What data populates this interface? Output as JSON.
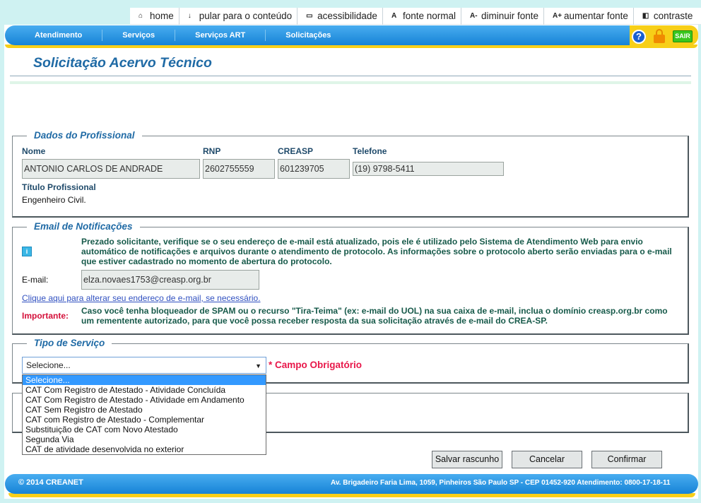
{
  "topbar": [
    {
      "icon": "⌂",
      "label": "home"
    },
    {
      "icon": "↓",
      "label": "pular para o conteúdo"
    },
    {
      "icon": "▭",
      "label": "acessibilidade"
    },
    {
      "icon": "A",
      "label": "fonte normal"
    },
    {
      "icon": "A-",
      "label": "diminuir fonte"
    },
    {
      "icon": "A+",
      "label": "aumentar fonte"
    },
    {
      "icon": "◧",
      "label": "contraste"
    }
  ],
  "nav": [
    "Atendimento",
    "Serviços",
    "Serviços ART",
    "Solicitações"
  ],
  "nav_buttons": {
    "help": "?",
    "sair": "SAIR"
  },
  "page_title": "Solicitação Acervo Técnico",
  "profissional": {
    "legend": "Dados do Profissional",
    "nome_label": "Nome",
    "nome": "ANTONIO CARLOS DE ANDRADE",
    "rnp_label": "RNP",
    "rnp": "2602755559",
    "creasp_label": "CREASP",
    "creasp": "601239705",
    "telefone_label": "Telefone",
    "telefone": "(19) 9798-5411",
    "titulo_label": "Título Profissional",
    "titulo": "Engenheiro Civil."
  },
  "email": {
    "legend": "Email de Notificações",
    "info": "Prezado solicitante, verifique se o seu endereço de e-mail está atualizado, pois ele é utilizado pelo Sistema de Atendimento Web para envio automático de notificações e arquivos durante o atendimento de protocolo. As informações sobre o protocolo aberto serão enviadas para o e-mail que estiver cadastrado no momento de abertura do protocolo.",
    "email_label": "E-mail:",
    "email_value": "elza.novaes1753@creasp.org.br",
    "change_link": "Clique aqui para alterar seu endereço de e-mail, se necessário.",
    "important_label": "Importante:",
    "important_text": "Caso você tenha bloqueador de SPAM ou o recurso \"Tira-Teima\" (ex: e-mail do UOL) na sua caixa de e-mail, inclua o domínio creasp.org.br como um rementente autorizado, para que você possa receber resposta da sua solicitação através de e-mail do CREA-SP."
  },
  "servico": {
    "legend": "Tipo de Serviço",
    "selected": "Selecione...",
    "required": "* Campo Obrigatório",
    "options": [
      "Selecione...",
      "CAT Com Registro de Atestado - Atividade Concluída",
      "CAT Com Registro de Atestado - Atividade em Andamento",
      "CAT Sem Registro de Atestado",
      "CAT com Registro de Atestado - Complementar",
      "Substituição de CAT com Novo Atestado",
      "Segunda Via",
      "CAT de atividade desenvolvida no exterior"
    ]
  },
  "buttons": {
    "save": "Salvar rascunho",
    "cancel": "Cancelar",
    "confirm": "Confirmar"
  },
  "footer": {
    "copyright": "© 2014 CREANET",
    "address": "Av. Brigadeiro Faria Lima, 1059, Pinheiros São Paulo SP - CEP 01452-920 Atendimento: 0800-17-18-11"
  }
}
